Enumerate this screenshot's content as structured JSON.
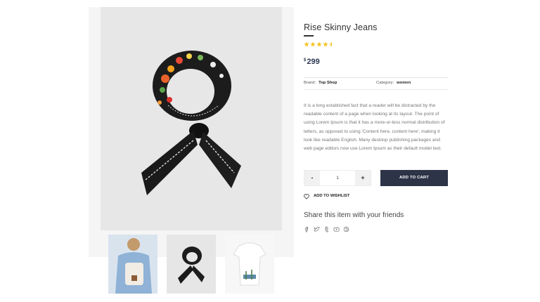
{
  "gallery": {
    "main_image_alt": "black floral bandana scarf",
    "thumbnails": [
      {
        "subject": "person with backpack"
      },
      {
        "subject": "scarf",
        "active": true
      },
      {
        "subject": "palm print shirt"
      }
    ]
  },
  "product": {
    "title": "Rise Skinny Jeans",
    "rating": 4.5,
    "rating_max": 5,
    "star_color": "#f4c21b",
    "currency_symbol": "$",
    "price": "299",
    "brand_label": "Brand:",
    "brand_value": "Top Shop",
    "category_label": "Category:",
    "category_value": "women",
    "description": "It is a long established fact that a reader will be distracted by the readable content of a page when looking at its layout. The point of using Lorem Ipsum is that it has a more-or-less normal distribution of letters, as opposed to using 'Content here, content here', making it look like readable English. Many desktop publishing packages and web page editors now use Lorem Ipsum as their default model text."
  },
  "cart": {
    "minus_label": "-",
    "quantity": "1",
    "plus_label": "+",
    "add_to_cart_label": "ADD TO CART",
    "button_color": "#2d3447",
    "wishlist_label": "ADD TO WISHLIST",
    "wishlist_icon": "heart-icon"
  },
  "share": {
    "title": "Share this item with your friends",
    "icons": [
      "facebook-icon",
      "twitter-icon",
      "tumblr-icon",
      "youtube-icon",
      "dribbble-icon"
    ]
  }
}
